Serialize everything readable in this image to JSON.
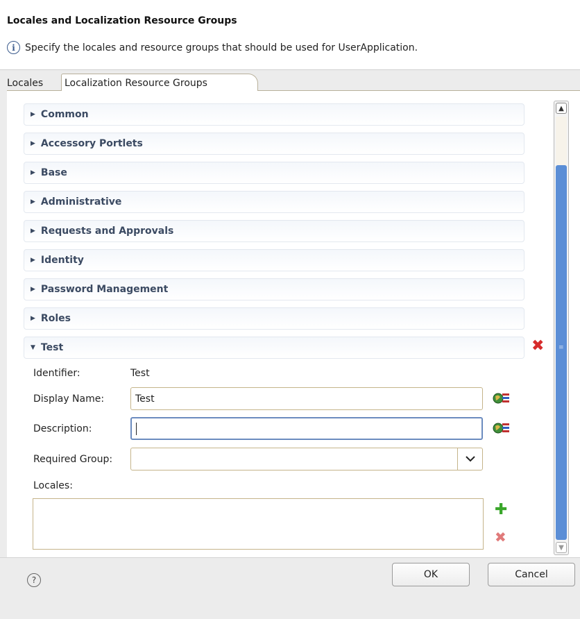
{
  "dialog": {
    "title": "Locales and Localization Resource Groups",
    "subtitle": "Specify the locales and resource groups that should be used for UserApplication."
  },
  "tabs": [
    {
      "label": "Locales",
      "active": false
    },
    {
      "label": "Localization Resource Groups",
      "active": true
    }
  ],
  "groups": [
    {
      "label": "Common",
      "expanded": false
    },
    {
      "label": "Accessory Portlets",
      "expanded": false
    },
    {
      "label": "Base",
      "expanded": false
    },
    {
      "label": "Administrative",
      "expanded": false
    },
    {
      "label": "Requests and Approvals",
      "expanded": false
    },
    {
      "label": "Identity",
      "expanded": false
    },
    {
      "label": "Password Management",
      "expanded": false
    },
    {
      "label": "Roles",
      "expanded": false
    },
    {
      "label": "Test",
      "expanded": true
    }
  ],
  "test_group": {
    "identifier_label": "Identifier:",
    "identifier_value": "Test",
    "display_name_label": "Display Name:",
    "display_name_value": "Test",
    "description_label": "Description:",
    "description_value": "",
    "required_group_label": "Required Group:",
    "required_group_value": "",
    "locales_label": "Locales:"
  },
  "footer": {
    "ok_label": "OK",
    "cancel_label": "Cancel"
  },
  "colors": {
    "accent": "#5b8ed6",
    "delete": "#d62b2b",
    "add": "#3aa62b"
  }
}
